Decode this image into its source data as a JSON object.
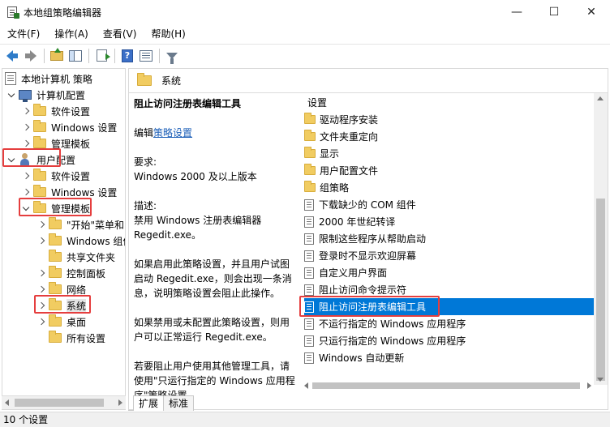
{
  "window": {
    "title": "本地组策略编辑器",
    "minimize": "—",
    "maximize": "☐",
    "close": "✕"
  },
  "menu": [
    "文件(F)",
    "操作(A)",
    "查看(V)",
    "帮助(H)"
  ],
  "toolbar": {
    "icons": [
      "back-arrow-icon",
      "forward-arrow-icon",
      "up-folder-icon",
      "show-hide-tree-icon",
      "export-list-icon",
      "help-icon",
      "view-icon",
      "filter-icon"
    ],
    "help_glyph": "?"
  },
  "tree": {
    "root": "本地计算机 策略",
    "computer_config": "计算机配置",
    "cc_software": "软件设置",
    "cc_windows": "Windows 设置",
    "cc_admin": "管理模板",
    "user_config": "用户配置",
    "uc_software": "软件设置",
    "uc_windows": "Windows 设置",
    "uc_admin": "管理模板",
    "start_menu": "\"开始\"菜单和",
    "windows_comp": "Windows 组件",
    "shared_folder": "共享文件夹",
    "control_panel": "控制面板",
    "network": "网络",
    "system": "系统",
    "desktop": "桌面",
    "all_settings": "所有设置"
  },
  "right": {
    "header_title": "系统",
    "desc": {
      "title": "阻止访问注册表编辑工具",
      "edit_prefix": "编辑",
      "edit_link": "策略设置",
      "req_label": "要求:",
      "req_value": "Windows 2000 及以上版本",
      "desc_label": "描述:",
      "desc_text": "禁用 Windows 注册表编辑器 Regedit.exe。",
      "enabled_text": "如果启用此策略设置，并且用户试图启动 Regedit.exe，则会出现一条消息，说明策略设置会阻止此操作。",
      "disabled_text": "如果禁用或未配置此策略设置，则用户可以正常运行 Regedit.exe。",
      "other_text": "若要阻止用户使用其他管理工具，请使用\"只运行指定的 Windows 应用程序\"策略设置。"
    },
    "list_header": "设置",
    "items": [
      {
        "label": "驱动程序安装",
        "type": "folder"
      },
      {
        "label": "文件夹重定向",
        "type": "folder"
      },
      {
        "label": "显示",
        "type": "folder"
      },
      {
        "label": "用户配置文件",
        "type": "folder"
      },
      {
        "label": "组策略",
        "type": "folder"
      },
      {
        "label": "下载缺少的 COM 组件",
        "type": "policy"
      },
      {
        "label": "2000 年世纪转译",
        "type": "policy"
      },
      {
        "label": "限制这些程序从帮助启动",
        "type": "policy"
      },
      {
        "label": "登录时不显示欢迎屏幕",
        "type": "policy"
      },
      {
        "label": "自定义用户界面",
        "type": "policy"
      },
      {
        "label": "阻止访问命令提示符",
        "type": "policy"
      },
      {
        "label": "阻止访问注册表编辑工具",
        "type": "policy",
        "selected": true
      },
      {
        "label": "不运行指定的 Windows 应用程序",
        "type": "policy"
      },
      {
        "label": "只运行指定的 Windows 应用程序",
        "type": "policy"
      },
      {
        "label": "Windows 自动更新",
        "type": "policy"
      }
    ]
  },
  "tabs": [
    "扩展",
    "标准"
  ],
  "status": "10 个设置",
  "colors": {
    "highlight": "#e53e3e",
    "selection": "#0078d7"
  }
}
